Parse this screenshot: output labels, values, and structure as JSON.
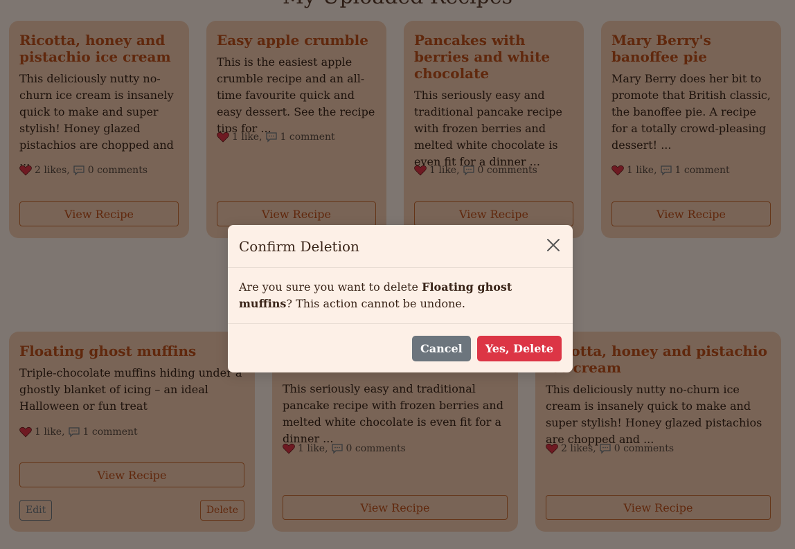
{
  "page": {
    "heading": "My Uploaded Recipes"
  },
  "colors": {
    "background": "#fdece2",
    "card": "#f2c9ad",
    "accent": "#c0501a",
    "overlay": "rgba(0,0,0,0.5)",
    "danger": "#dc3545",
    "secondary": "#6c757d",
    "heart": "#dc3545"
  },
  "icons": {
    "like": "heart-icon",
    "comment": "comment-bubble-icon",
    "close": "close-icon"
  },
  "top_cards": [
    {
      "title": "Ricotta, honey and pistachio ice cream",
      "description": "This deliciously nutty no-churn ice cream is insanely quick to make and super stylish! Honey glazed pistachios are chopped and ...",
      "likes": "2 likes,",
      "comments": "0 comments",
      "view_label": "View Recipe"
    },
    {
      "title": "Easy apple crumble",
      "description": "This is the easiest apple crumble recipe and an all-time favourite quick and easy dessert. See the recipe tips for ...",
      "likes": "1 like,",
      "comments": "1 comment",
      "view_label": "View Recipe"
    },
    {
      "title": "Pancakes with berries and white chocolate",
      "description": "This seriously easy and traditional pancake recipe with frozen berries and melted white chocolate is even fit for a dinner ...",
      "likes": "1 like,",
      "comments": "0 comments",
      "view_label": "View Recipe"
    },
    {
      "title": "Mary Berry's banoffee pie",
      "description": "Mary Berry does her bit to promote that British classic, the banoffee pie. A recipe for a totally crowd-pleasing dessert! ...",
      "likes": "1 like,",
      "comments": "1 comment",
      "view_label": "View Recipe"
    }
  ],
  "bottom_cards": [
    {
      "title": "Floating ghost muffins",
      "description": "Triple-chocolate muffins hiding under a ghostly blanket of icing – an ideal Halloween or fun treat",
      "likes": "1 like,",
      "comments": "1 comment",
      "view_label": "View Recipe",
      "edit_label": "Edit",
      "delete_label": "Delete"
    },
    {
      "title": "",
      "description": "This seriously easy and traditional pancake recipe with frozen berries and melted white chocolate is even fit for a dinner ...",
      "likes": "1 like,",
      "comments": "0 comments",
      "view_label": "View Recipe"
    },
    {
      "title": "Ricotta, honey and pistachio ice cream",
      "description": "This deliciously nutty no-churn ice cream is insanely quick to make and super stylish! Honey glazed pistachios are chopped and ...",
      "likes": "2 likes,",
      "comments": "0 comments",
      "view_label": "View Recipe"
    }
  ],
  "modal": {
    "title": "Confirm Deletion",
    "body_prefix": "Are you sure you want to delete ",
    "body_target": "Floating ghost muffins",
    "body_suffix": "? This action cannot be undone.",
    "cancel_label": "Cancel",
    "confirm_label": "Yes, Delete"
  }
}
